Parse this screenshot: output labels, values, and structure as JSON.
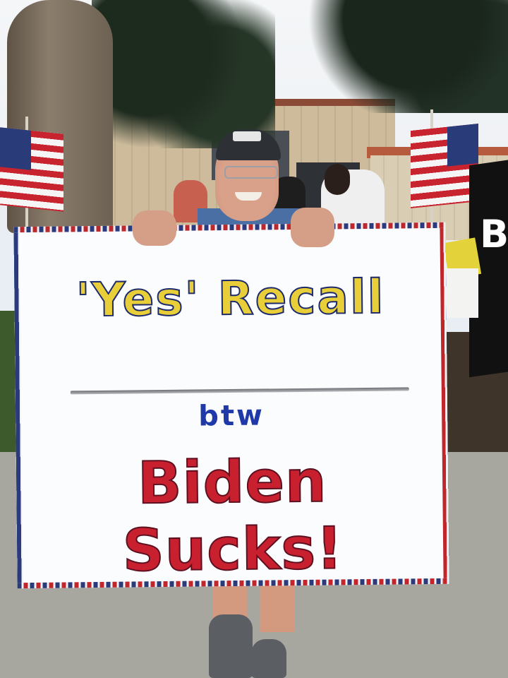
{
  "photo": {
    "sign": {
      "line1": "'Yes' Recall",
      "line2": "btw",
      "line3": "Biden Sucks!"
    },
    "background_flag_text": "B",
    "colors": {
      "line1_fill": "#e8cf3a",
      "line1_outline": "#1d2a6b",
      "line2": "#1f3aa8",
      "line3": "#c8202f",
      "sign_border_blue": "#2b3a7c",
      "sign_border_red": "#c0272d"
    },
    "icons": [
      "american-flag-icon",
      "american-flag-icon"
    ]
  }
}
